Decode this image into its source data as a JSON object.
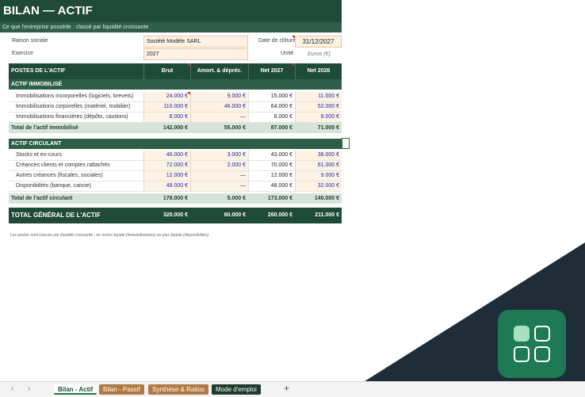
{
  "header": {
    "title": "BILAN — ACTIF",
    "subtitle": "Ce que l'entreprise possède : classé par liquidité croissante"
  },
  "info": {
    "company_label": "Raison sociale",
    "company_value": "Société Modèle SARL",
    "year_label": "Exercice",
    "year_value": "2027",
    "close_label": "Date de clôture",
    "close_value": "31/12/2027",
    "unit_label": "Unité",
    "unit_value": "Euros (€)"
  },
  "table": {
    "headers": [
      "POSTES DE L'ACTIF",
      "Brut",
      "Amort. & dépréc.",
      "Net 2027",
      "Net 2026"
    ],
    "sections": [
      {
        "title": "ACTIF IMMOBILISÉ",
        "rows": [
          [
            "Immobilisations incorporelles (logiciels, brevets)",
            "24.000 €",
            "9.000 €",
            "15.000 €",
            "11.000 €"
          ],
          [
            "Immobilisations corporelles (matériel, mobilier)",
            "110.000 €",
            "46.000 €",
            "64.000 €",
            "52.000 €"
          ],
          [
            "Immobilisations financières (dépôts, cautions)",
            "8.000 €",
            "—",
            "8.000 €",
            "8.000 €"
          ]
        ],
        "total": [
          "Total de l'actif immobilisé",
          "142.000 €",
          "55.000 €",
          "87.000 €",
          "71.000 €"
        ]
      },
      {
        "title": "ACTIF CIRCULANT",
        "rows": [
          [
            "Stocks et en-cours",
            "46.000 €",
            "3.000 €",
            "43.000 €",
            "38.000 €"
          ],
          [
            "Créances clients et comptes rattachés",
            "72.000 €",
            "2.000 €",
            "70.000 €",
            "61.000 €"
          ],
          [
            "Autres créances (fiscales, sociales)",
            "12.000 €",
            "—",
            "12.000 €",
            "9.000 €"
          ],
          [
            "Disponibilités (banque, caisse)",
            "48.000 €",
            "—",
            "48.000 €",
            "32.000 €"
          ]
        ],
        "total": [
          "Total de l'actif circulant",
          "178.000 €",
          "5.000 €",
          "173.000 €",
          "140.000 €"
        ]
      }
    ],
    "grand_total": [
      "TOTAL GÉNÉRAL DE L'ACTIF",
      "320.000 €",
      "60.000 €",
      "260.000 €",
      "211.000 €"
    ]
  },
  "footnote": "Les postes sont classés par liquidité croissante : du moins liquide (immobilisations) au plus liquide (disponibilités)",
  "tabs": {
    "prev": "‹",
    "next": "›",
    "items": [
      "Bilan - Actif",
      "Bilan - Passif",
      "Synthèse & Ratios",
      "Mode d'emploi"
    ],
    "add": "+"
  },
  "colors": {
    "primary": "#1f4a38",
    "section": "#2e5e49",
    "input_fill": "#fdf2e3",
    "input_text": "#1d2cb0",
    "total_fill": "#d6e3da",
    "corner": "#1f2d38",
    "logo": "#1e7a55",
    "logo_light": "#a8e0c4"
  }
}
